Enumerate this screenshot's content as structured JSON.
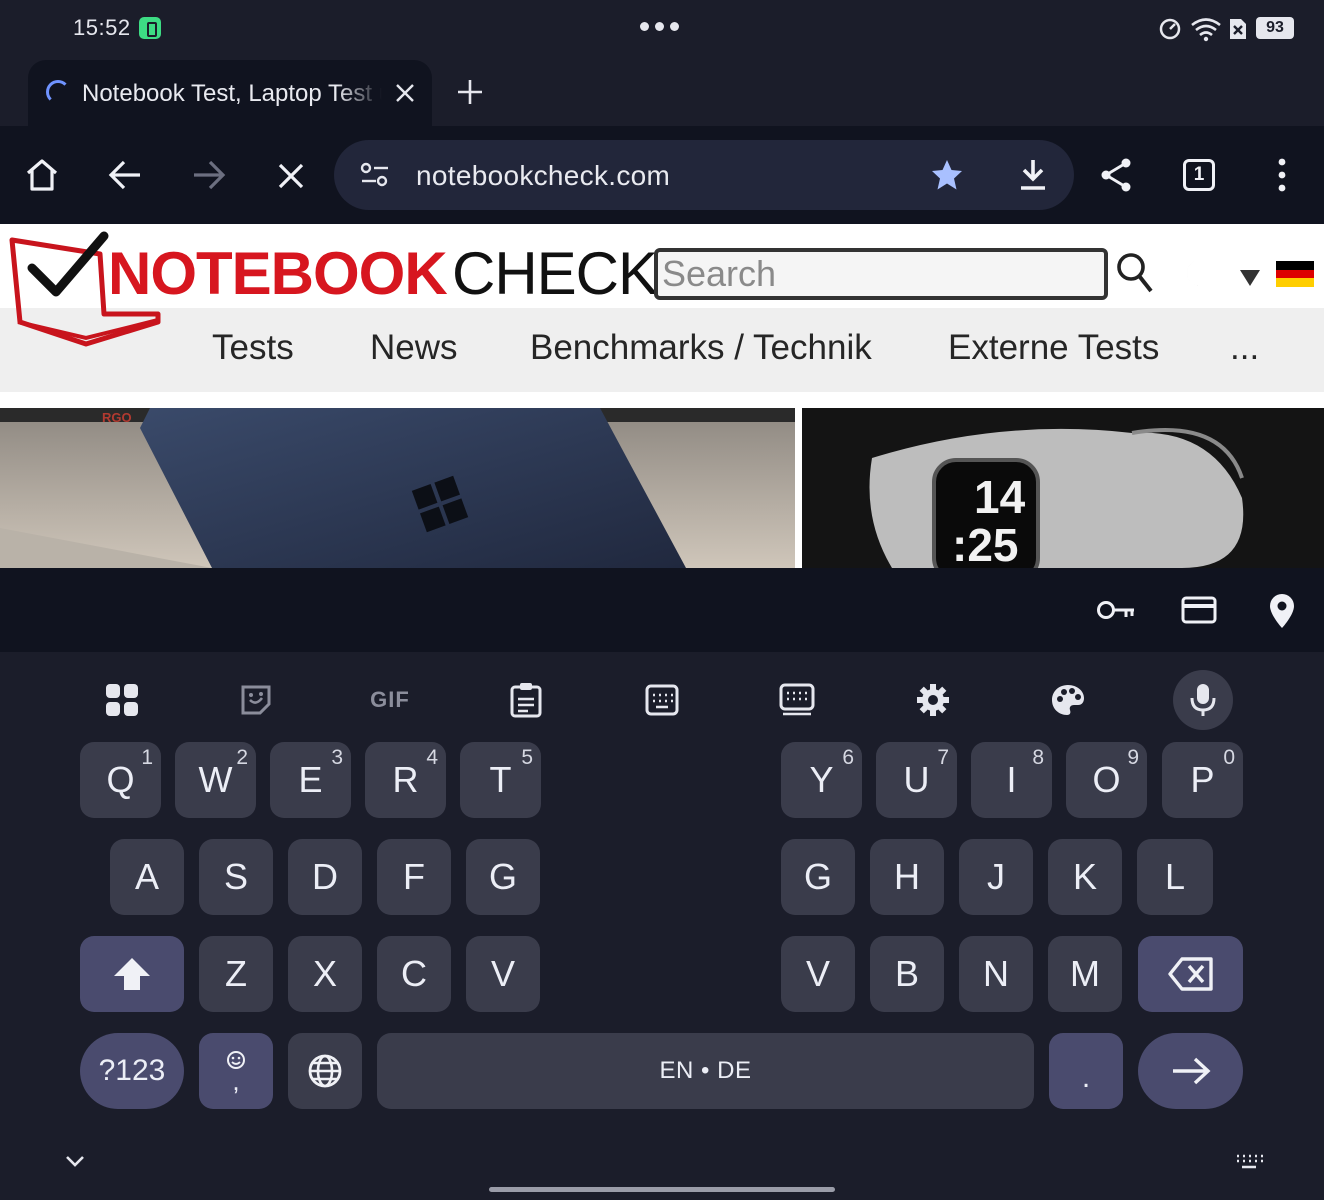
{
  "status_bar": {
    "time": "15:52",
    "battery_level": "93",
    "icons": [
      "battery-saver-icon",
      "more-dots-icon",
      "data-saver-icon",
      "wifi-icon",
      "no-sim-icon",
      "battery-icon"
    ]
  },
  "tabs": [
    {
      "title": "Notebook Test, Laptop Test und News",
      "close_icon": "close-icon"
    }
  ],
  "toolbar": {
    "url": "notebookcheck.com",
    "tab_count": "1",
    "icons": [
      "home-icon",
      "back-icon",
      "forward-icon",
      "stop-icon",
      "site-settings-icon",
      "bookmark-star-icon",
      "download-icon",
      "share-icon",
      "tab-switcher-icon",
      "menu-icon"
    ]
  },
  "webpage": {
    "logo": {
      "part1": "NOTEBOOK",
      "part2": "CHECK"
    },
    "search_placeholder": "Search",
    "nav": [
      "Tests",
      "News",
      "Benchmarks / Technik",
      "Externe Tests",
      "..."
    ],
    "thumbnails": {
      "laptop_brand": "RGO",
      "watch_hours": "14",
      "watch_minutes": ":25"
    }
  },
  "autofill": {
    "icons": [
      "password-key-icon",
      "payment-card-icon",
      "address-pin-icon"
    ]
  },
  "keyboard": {
    "toolbar_icons": [
      "apps-grid-icon",
      "sticker-icon",
      "gif-icon",
      "clipboard-icon",
      "one-handed-keyboard-icon",
      "split-keyboard-icon",
      "settings-gear-icon",
      "theme-palette-icon",
      "microphone-icon"
    ],
    "gif_label": "GIF",
    "rows": {
      "row1_left": [
        {
          "k": "Q",
          "h": "1"
        },
        {
          "k": "W",
          "h": "2"
        },
        {
          "k": "E",
          "h": "3"
        },
        {
          "k": "R",
          "h": "4"
        },
        {
          "k": "T",
          "h": "5"
        }
      ],
      "row1_right": [
        {
          "k": "Y",
          "h": "6"
        },
        {
          "k": "U",
          "h": "7"
        },
        {
          "k": "I",
          "h": "8"
        },
        {
          "k": "O",
          "h": "9"
        },
        {
          "k": "P",
          "h": "0"
        }
      ],
      "row2_left": [
        "A",
        "S",
        "D",
        "F",
        "G"
      ],
      "row2_right": [
        "G",
        "H",
        "J",
        "K",
        "L"
      ],
      "row3_left": [
        "Z",
        "X",
        "C",
        "V"
      ],
      "row3_right": [
        "V",
        "B",
        "N",
        "M"
      ]
    },
    "symbols_label": "?123",
    "comma_label": ",",
    "space_label": "EN • DE",
    "period_label": ".",
    "colors": {
      "key": "#3a3c4b",
      "modifier": "#4a4b6e",
      "background": "#1b1d2a"
    }
  }
}
